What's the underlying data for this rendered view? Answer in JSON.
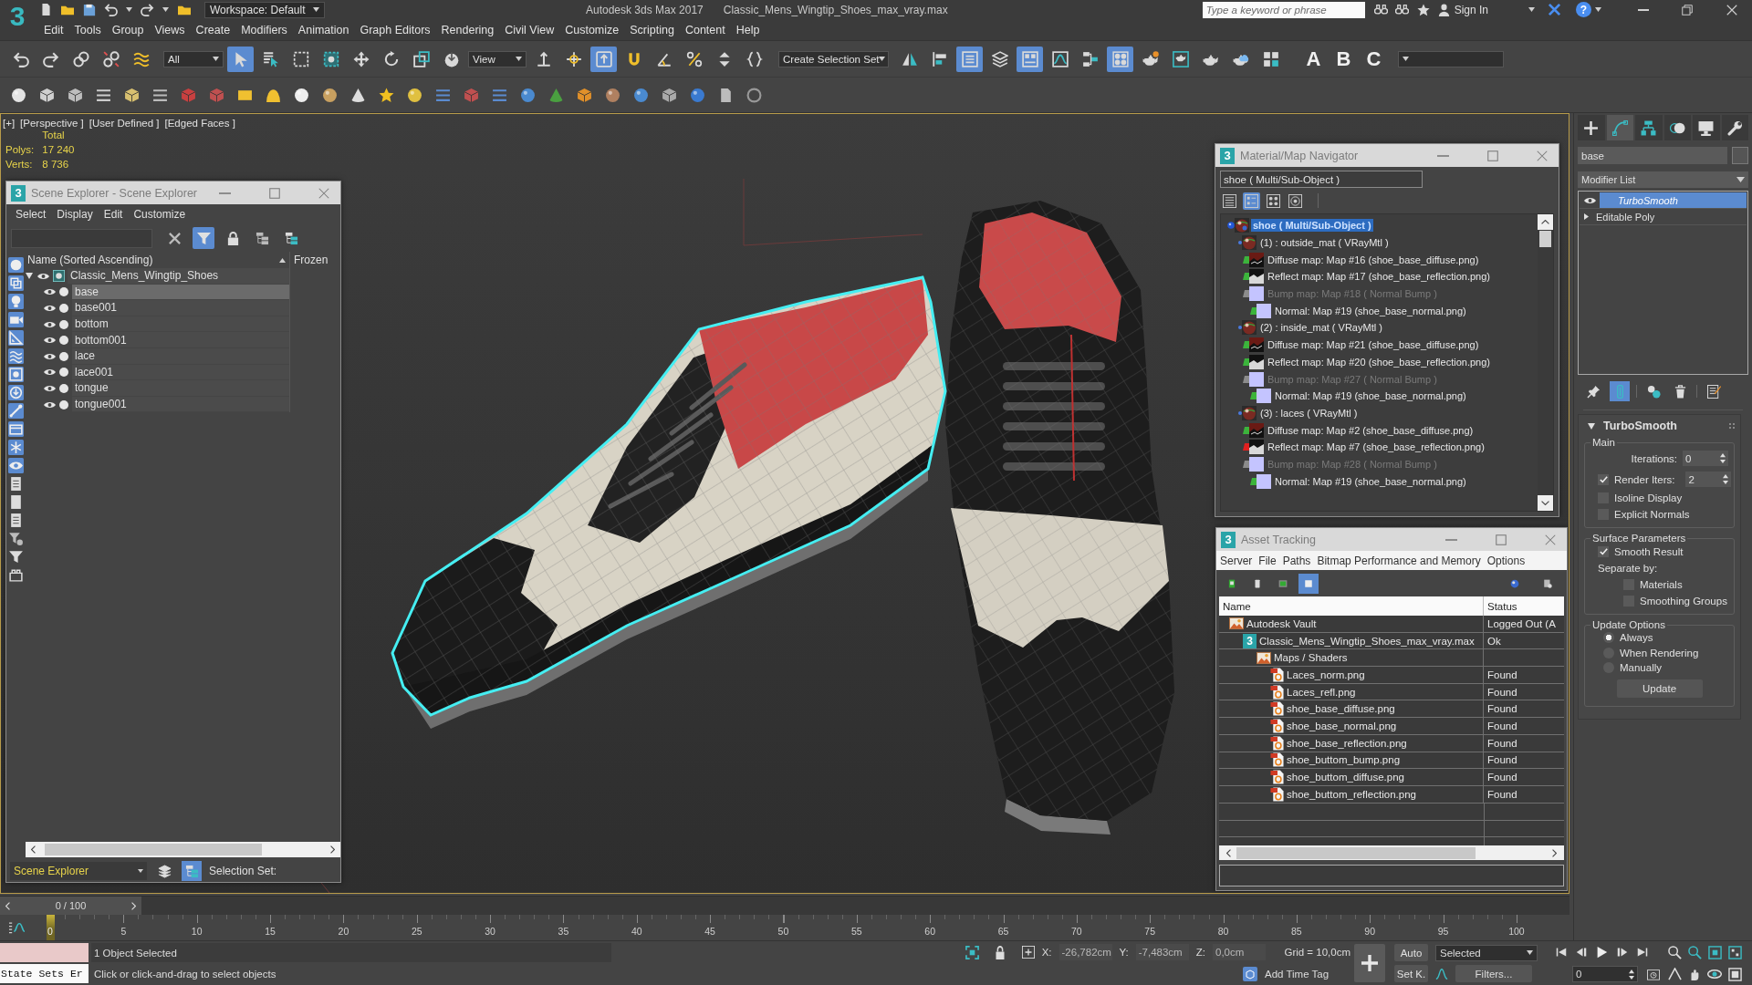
{
  "title_bar": {
    "logo": "3",
    "workspace": "Workspace: Default",
    "app_title": "Autodesk 3ds Max 2017",
    "file_name": "Classic_Mens_Wingtip_Shoes_max_vray.max",
    "search": {
      "placeholder": "Type a keyword or phrase"
    },
    "sign_in": "Sign In",
    "help": "?"
  },
  "menu_bar": [
    "Edit",
    "Tools",
    "Group",
    "Views",
    "Create",
    "Modifiers",
    "Animation",
    "Graph Editors",
    "Rendering",
    "Civil View",
    "Customize",
    "Scripting",
    "Content",
    "Help"
  ],
  "main_toolbar": {
    "items": [
      {
        "kind": "button",
        "selected": false
      },
      {
        "kind": "button",
        "selected": false
      },
      {
        "kind": "button",
        "selected": false
      },
      {
        "kind": "button",
        "selected": false
      },
      {
        "kind": "button",
        "selected": false
      },
      {
        "kind": "dropdown",
        "value": "All"
      },
      {
        "kind": "button",
        "selected": true
      },
      {
        "kind": "button",
        "selected": false
      },
      {
        "kind": "button",
        "selected": false
      },
      {
        "kind": "button",
        "selected": false
      },
      {
        "kind": "button",
        "selected": false
      },
      {
        "kind": "button",
        "selected": false
      },
      {
        "kind": "button",
        "selected": false
      },
      {
        "kind": "button",
        "selected": false
      },
      {
        "kind": "dropdown",
        "value": "View"
      },
      {
        "kind": "button",
        "selected": false
      },
      {
        "kind": "button",
        "selected": false
      },
      {
        "kind": "button",
        "selected": true
      },
      {
        "kind": "button",
        "selected": false
      },
      {
        "kind": "button",
        "selected": false
      },
      {
        "kind": "button",
        "selected": false
      },
      {
        "kind": "button",
        "selected": false
      },
      {
        "kind": "button",
        "selected": false
      },
      {
        "kind": "dropdown",
        "value": "Create Selection Set"
      },
      {
        "kind": "button",
        "selected": false
      },
      {
        "kind": "button",
        "selected": false
      },
      {
        "kind": "button",
        "selected": true
      },
      {
        "kind": "button",
        "selected": false
      },
      {
        "kind": "button",
        "selected": true
      },
      {
        "kind": "button",
        "selected": false
      },
      {
        "kind": "button",
        "selected": false
      },
      {
        "kind": "button",
        "selected": true
      },
      {
        "kind": "button",
        "selected": false
      },
      {
        "kind": "button",
        "selected": false
      },
      {
        "kind": "button",
        "selected": false
      },
      {
        "kind": "button",
        "selected": false
      },
      {
        "kind": "button",
        "selected": false
      },
      {
        "kind": "glyph",
        "text": "A",
        "selected": false
      },
      {
        "kind": "glyph",
        "text": "B",
        "selected": false
      },
      {
        "kind": "glyph",
        "text": "C",
        "selected": false
      },
      {
        "kind": "dropdown"
      }
    ]
  },
  "viewport": {
    "labels": [
      "[+]",
      "[Perspective ]",
      "[User Defined ]",
      "[Edged Faces ]"
    ],
    "stats": {
      "heading": "Total",
      "rows": [
        {
          "label": "Polys:",
          "value": "17 240"
        },
        {
          "label": "Verts:",
          "value": "8 736"
        }
      ]
    }
  },
  "scene_explorer": {
    "logo": "3",
    "title": "Scene Explorer - Scene Explorer",
    "menu": [
      "Select",
      "Display",
      "Edit",
      "Customize"
    ],
    "toolbar": [
      {
        "selected": false
      },
      {
        "selected": true
      },
      {
        "selected": false
      },
      {
        "selected": false
      },
      {
        "selected": false
      }
    ],
    "filters": [
      {
        "selected": true
      },
      {
        "selected": true
      },
      {
        "selected": true
      },
      {
        "selected": true
      },
      {
        "selected": true
      },
      {
        "selected": true
      },
      {
        "selected": true
      },
      {
        "selected": true
      },
      {
        "selected": true
      },
      {
        "selected": true
      },
      {
        "selected": true
      },
      {
        "selected": true
      },
      {
        "selected": false
      },
      {
        "selected": false
      },
      {
        "selected": false
      },
      {
        "selected": false
      },
      {
        "selected": false
      },
      {
        "selected": false
      }
    ],
    "columns": [
      "Name (Sorted Ascending)",
      "Frozen"
    ],
    "tree": [
      {
        "name": "Classic_Mens_Wingtip_Shoes",
        "expanded": true,
        "selected": false,
        "children": [
          {
            "name": "base",
            "selected": true
          },
          {
            "name": "base001",
            "selected": false
          },
          {
            "name": "bottom",
            "selected": false
          },
          {
            "name": "bottom001",
            "selected": false
          },
          {
            "name": "lace",
            "selected": false
          },
          {
            "name": "lace001",
            "selected": false
          },
          {
            "name": "tongue",
            "selected": false
          },
          {
            "name": "tongue001",
            "selected": false
          }
        ]
      }
    ],
    "footer": {
      "explorer": "Scene Explorer",
      "tools": [
        {
          "selected": false
        },
        {
          "selected": true
        }
      ],
      "selection_set": "Selection Set:"
    }
  },
  "material_navigator": {
    "logo": "3",
    "title": "Material/Map Navigator",
    "current": "shoe ( Multi/Sub-Object )",
    "view_modes": [
      {
        "selected": false
      },
      {
        "selected": true
      },
      {
        "selected": false
      },
      {
        "selected": false
      }
    ],
    "tree": [
      {
        "label": "shoe ( Multi/Sub-Object )",
        "kind": "multi",
        "selected": true,
        "children": [
          {
            "label": "(1) : outside_mat ( VRayMtl )",
            "kind": "material",
            "selected": false,
            "disabled": false,
            "children": [
              {
                "label": "Diffuse map: Map #16 (shoe_base_diffuse.png)",
                "kind": "diffuse",
                "color": "#3cb43c",
                "selected": false,
                "disabled": false
              },
              {
                "label": "Reflect map: Map #17 (shoe_base_reflection.png)",
                "kind": "reflect",
                "color": "#3cb43c",
                "selected": false,
                "disabled": false
              },
              {
                "label": "Bump map: Map #18 ( Normal Bump )",
                "kind": "bump",
                "color": "#8c8c8c",
                "selected": false,
                "disabled": true,
                "children": [
                  {
                    "label": "Normal: Map #19 (shoe_base_normal.png)",
                    "kind": "normal",
                    "color": "#3cb43c",
                    "selected": false,
                    "disabled": false
                  }
                ]
              }
            ]
          },
          {
            "label": "(2) : inside_mat ( VRayMtl )",
            "kind": "material",
            "selected": false,
            "disabled": false,
            "children": [
              {
                "label": "Diffuse map: Map #21 (shoe_base_diffuse.png)",
                "kind": "diffuse",
                "color": "#3cb43c",
                "selected": false,
                "disabled": false
              },
              {
                "label": "Reflect map: Map #20 (shoe_base_reflection.png)",
                "kind": "reflect",
                "color": "#3cb43c",
                "selected": false,
                "disabled": false
              },
              {
                "label": "Bump map: Map #27 ( Normal Bump )",
                "kind": "bump",
                "color": "#8c8c8c",
                "selected": false,
                "disabled": true,
                "children": [
                  {
                    "label": "Normal: Map #19 (shoe_base_normal.png)",
                    "kind": "normal",
                    "color": "#3cb43c",
                    "selected": false,
                    "disabled": false
                  }
                ]
              }
            ]
          },
          {
            "label": "(3) : laces ( VRayMtl )",
            "kind": "material",
            "selected": false,
            "disabled": false,
            "children": [
              {
                "label": "Diffuse map: Map #2 (shoe_base_diffuse.png)",
                "kind": "diffuse",
                "color": "#3cb43c",
                "selected": false,
                "disabled": false
              },
              {
                "label": "Reflect map: Map #7 (shoe_base_reflection.png)",
                "kind": "reflect",
                "color": "#e02020",
                "selected": false,
                "disabled": false
              },
              {
                "label": "Bump map: Map #28 ( Normal Bump )",
                "kind": "bump",
                "color": "#8c8c8c",
                "selected": false,
                "disabled": true,
                "children": [
                  {
                    "label": "Normal: Map #19 (shoe_base_normal.png)",
                    "kind": "normal",
                    "color": "#3cb43c",
                    "selected": false,
                    "disabled": false
                  }
                ]
              }
            ]
          }
        ]
      }
    ]
  },
  "asset_tracking": {
    "logo": "3",
    "title": "Asset Tracking",
    "menu": [
      "Server",
      "File",
      "Paths",
      "Bitmap Performance and Memory",
      "Options"
    ],
    "toolbar": [
      {
        "selected": false
      },
      {
        "selected": false
      },
      {
        "selected": false
      },
      {
        "selected": true
      }
    ],
    "columns": [
      "Name",
      "Status"
    ],
    "tree": [
      {
        "name": "Autodesk Vault",
        "status": "Logged Out (A",
        "kind": "vault",
        "children": [
          {
            "name": "Classic_Mens_Wingtip_Shoes_max_vray.max",
            "status": "Ok",
            "kind": "scene",
            "badge": "3",
            "children": [
              {
                "name": "Maps / Shaders",
                "kind": "folder",
                "children": [
                  {
                    "name": "Laces_norm.png",
                    "status": "Found",
                    "kind": "image"
                  },
                  {
                    "name": "Laces_refl.png",
                    "status": "Found",
                    "kind": "image"
                  },
                  {
                    "name": "shoe_base_diffuse.png",
                    "status": "Found",
                    "kind": "image"
                  },
                  {
                    "name": "shoe_base_normal.png",
                    "status": "Found",
                    "kind": "image"
                  },
                  {
                    "name": "shoe_base_reflection.png",
                    "status": "Found",
                    "kind": "image"
                  },
                  {
                    "name": "shoe_buttom_bump.png",
                    "status": "Found",
                    "kind": "image"
                  },
                  {
                    "name": "shoe_buttom_diffuse.png",
                    "status": "Found",
                    "kind": "image"
                  },
                  {
                    "name": "shoe_buttom_reflection.png",
                    "status": "Found",
                    "kind": "image"
                  }
                ]
              }
            ]
          }
        ]
      }
    ]
  },
  "command_panel": {
    "tabs": [
      {
        "selected": false
      },
      {
        "selected": true
      },
      {
        "selected": false
      },
      {
        "selected": false
      },
      {
        "selected": false
      },
      {
        "selected": false
      }
    ],
    "object_name": "base",
    "modifier_list": "Modifier List",
    "stack": [
      {
        "name": "TurboSmooth",
        "kind": "modifier",
        "selected": true
      },
      {
        "name": "Editable Poly",
        "kind": "base_object",
        "selected": false
      }
    ],
    "stack_tools": [
      {
        "selected": false
      },
      {
        "selected": true
      },
      {
        "selected": false
      },
      {
        "selected": false
      },
      {
        "selected": false
      }
    ],
    "rollout": {
      "title": "TurboSmooth",
      "expanded": true,
      "groups": [
        {
          "title": "Main",
          "controls": [
            {
              "kind": "spinner",
              "label": "Iterations:",
              "value": "0"
            },
            {
              "kind": "check_spinner",
              "label": "Render Iters:",
              "checked": true,
              "value": "2"
            },
            {
              "kind": "checkbox",
              "label": "Isoline Display",
              "checked": false
            },
            {
              "kind": "checkbox",
              "label": "Explicit Normals",
              "checked": false
            }
          ]
        },
        {
          "title": "Surface Parameters",
          "controls": [
            {
              "kind": "checkbox",
              "label": "Smooth Result",
              "checked": true
            },
            {
              "kind": "label",
              "label": "Separate by:",
              "children": [
                {
                  "kind": "checkbox",
                  "label": "Materials",
                  "checked": false
                },
                {
                  "kind": "checkbox",
                  "label": "Smoothing Groups",
                  "checked": false
                }
              ]
            }
          ]
        },
        {
          "title": "Update Options",
          "controls": [
            {
              "kind": "radio",
              "label": "Always",
              "selected": true
            },
            {
              "kind": "radio",
              "label": "When Rendering",
              "selected": false
            },
            {
              "kind": "radio",
              "label": "Manually",
              "selected": false
            },
            {
              "kind": "button",
              "label": "Update"
            }
          ]
        }
      ]
    }
  },
  "time_slider": {
    "label": "0 / 100",
    "level": 0
  },
  "track_bar": {
    "ticks": [
      "0",
      "5",
      "10",
      "15",
      "20",
      "25",
      "30",
      "35",
      "40",
      "45",
      "50",
      "55",
      "60",
      "65",
      "70",
      "75",
      "80",
      "85",
      "90",
      "95",
      "100"
    ]
  },
  "status_bar": {
    "listener": "State Sets Er",
    "selection": "1 Object Selected",
    "prompt": "Click or click-and-drag to select objects",
    "coords": [
      {
        "axis": "X:",
        "value": "-26,782cm"
      },
      {
        "axis": "Y:",
        "value": "-7,483cm"
      },
      {
        "axis": "Z:",
        "value": "0,0cm"
      }
    ],
    "grid": "Grid = 10,0cm",
    "time_tag": "Add Time Tag",
    "auto_key": "Auto",
    "key_filter_set": "Selected",
    "set_key": "Set K.",
    "filters": "Filters...",
    "frame": "0"
  }
}
